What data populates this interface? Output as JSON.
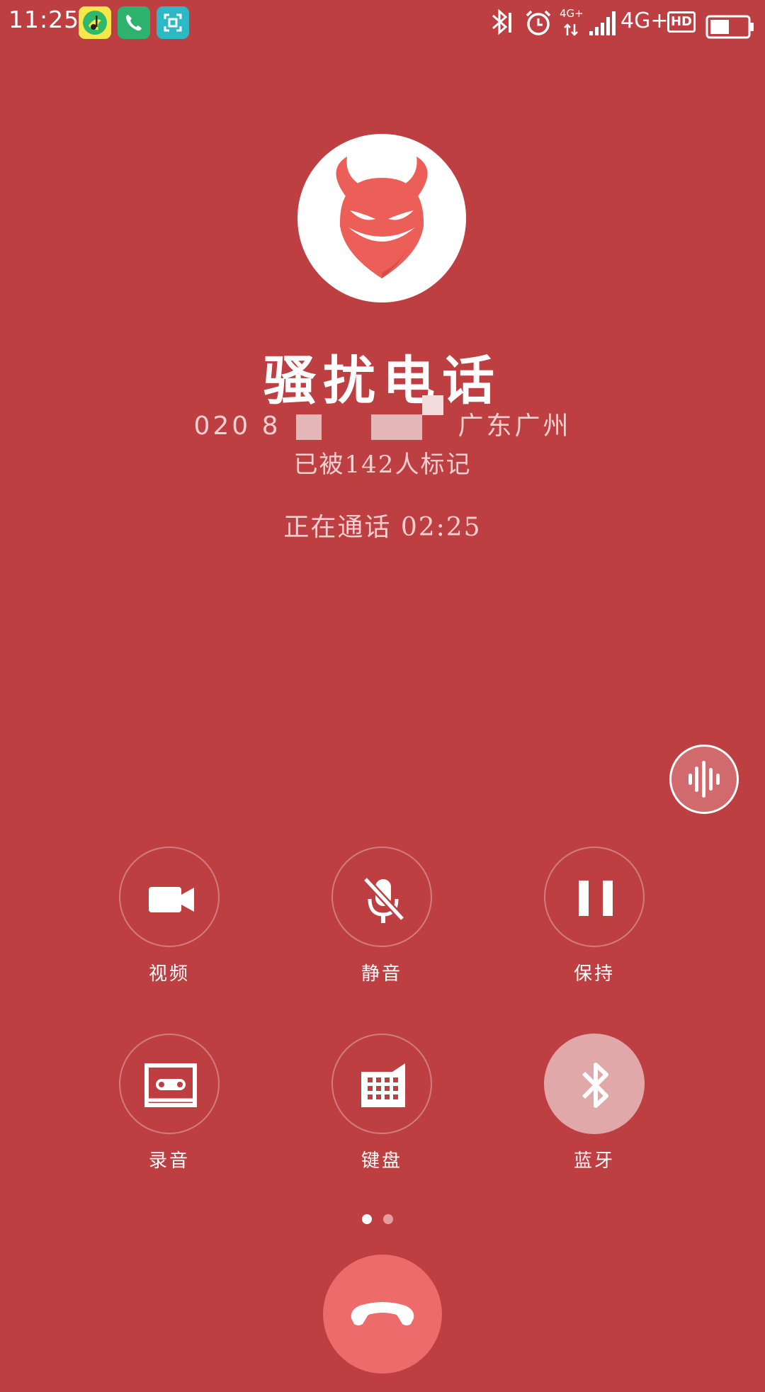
{
  "status_bar": {
    "time": "11:25",
    "network_small": "4G+",
    "network": "4G+",
    "hd": "HD"
  },
  "contact": {
    "name": "骚扰电话",
    "number_prefix": "020 8",
    "location": "广东广州",
    "mark_count": "已被142人标记",
    "call_status": "正在通话 02:25"
  },
  "controls": {
    "video": "视频",
    "mute": "静音",
    "hold": "保持",
    "record": "录音",
    "keypad": "键盘",
    "bluetooth": "蓝牙"
  },
  "icons": {
    "avatar": "devil-icon",
    "voice": "sound-wave-icon",
    "end_call": "hang-up-icon"
  },
  "colors": {
    "background": "#bd3f42",
    "end_call": "#ee6b6c",
    "devil": "#ec5e58"
  }
}
